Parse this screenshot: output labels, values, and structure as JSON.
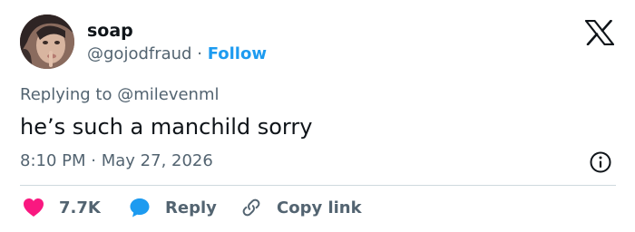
{
  "author": {
    "display_name": "soap",
    "handle": "@gojodfraud",
    "separator": "·",
    "follow_label": "Follow"
  },
  "reply_context": {
    "prefix": "Replying to",
    "mention": "@milevenml"
  },
  "tweet": {
    "text": "he’s such a manchild sorry",
    "time": "8:10 PM",
    "separator": "·",
    "date": "May 27, 2026"
  },
  "actions": {
    "likes": "7.7K",
    "reply_label": "Reply",
    "copy_link_label": "Copy link"
  },
  "colors": {
    "accent": "#1d9bf0",
    "like_heart": "#f91880",
    "secondary_text": "#536471",
    "primary_text": "#0f1419"
  },
  "icons": [
    "x-logo-icon",
    "info-icon",
    "heart-icon",
    "speech-bubble-icon",
    "link-icon"
  ]
}
